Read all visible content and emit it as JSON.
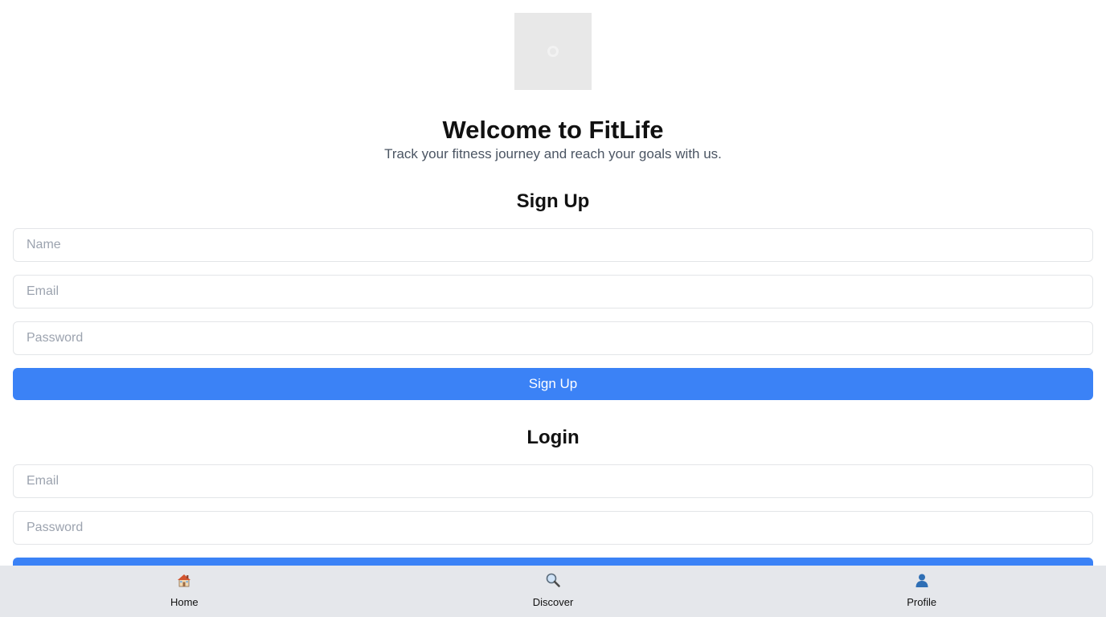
{
  "header": {
    "title": "Welcome to FitLife",
    "subtitle": "Track your fitness journey and reach your goals with us."
  },
  "signup": {
    "heading": "Sign Up",
    "name_placeholder": "Name",
    "email_placeholder": "Email",
    "password_placeholder": "Password",
    "button_label": "Sign Up"
  },
  "login": {
    "heading": "Login",
    "email_placeholder": "Email",
    "password_placeholder": "Password"
  },
  "bottom_nav": {
    "items": [
      {
        "label": "Home",
        "icon": "home-icon"
      },
      {
        "label": "Discover",
        "icon": "search-icon"
      },
      {
        "label": "Profile",
        "icon": "user-icon"
      }
    ]
  },
  "colors": {
    "accent": "#3b82f6",
    "nav_background": "#e5e7eb",
    "subtitle_text": "#4b5563",
    "placeholder_text": "#9ca3af",
    "logo_placeholder": "#e8e8e8"
  }
}
